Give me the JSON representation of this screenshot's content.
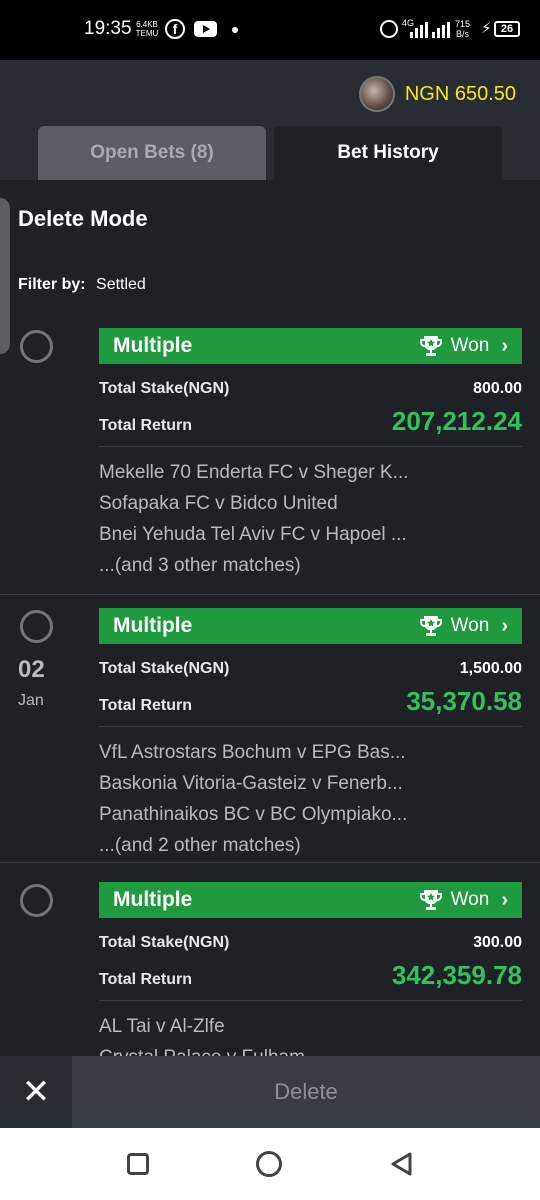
{
  "status_bar": {
    "time": "19:35",
    "net_mini_top": "6.4KB",
    "net_mini_bottom": "TEMU",
    "network_label": "4G",
    "speed_top": "715",
    "speed_bottom": "B/s",
    "battery": "26",
    "icons": [
      "facebook-icon",
      "youtube-icon",
      "dot-icon",
      "alarm-icon",
      "signal-icon",
      "battery-icon"
    ]
  },
  "header": {
    "balance": "NGN 650.50"
  },
  "tabs": {
    "open_bets": "Open Bets (8)",
    "bet_history": "Bet History"
  },
  "panel": {
    "title": "Delete Mode",
    "filter_label": "Filter by:",
    "filter_value": "Settled"
  },
  "bets": [
    {
      "type": "Multiple",
      "status": "Won",
      "stake_label": "Total Stake(NGN)",
      "stake": "800.00",
      "return_label": "Total Return",
      "return": "207,212.24",
      "matches": [
        "Mekelle 70 Enderta FC v Sheger K...",
        "Sofapaka FC v Bidco United",
        "Bnei Yehuda Tel Aviv FC v Hapoel ...",
        "...(and 3 other matches)"
      ]
    },
    {
      "date_day": "02",
      "date_month": "Jan",
      "type": "Multiple",
      "status": "Won",
      "stake_label": "Total Stake(NGN)",
      "stake": "1,500.00",
      "return_label": "Total Return",
      "return": "35,370.58",
      "matches": [
        "VfL Astrostars Bochum v EPG Bas...",
        "Baskonia Vitoria-Gasteiz v Fenerb...",
        "Panathinaikos BC v BC Olympiako...",
        "...(and 2 other matches)"
      ]
    },
    {
      "type": "Multiple",
      "status": "Won",
      "stake_label": "Total Stake(NGN)",
      "stake": "300.00",
      "return_label": "Total Return",
      "return": "342,359.78",
      "matches": [
        "AL Tai v Al-Zlfe",
        "Crystal Palace v Fulham"
      ]
    }
  ],
  "bottom_bar": {
    "close_symbol": "✕",
    "delete_label": "Delete"
  },
  "colors": {
    "won_green": "#1f9a3e",
    "return_green": "#2fc35b",
    "balance_yellow": "#f5e622",
    "panel_bg": "#1f2127"
  }
}
